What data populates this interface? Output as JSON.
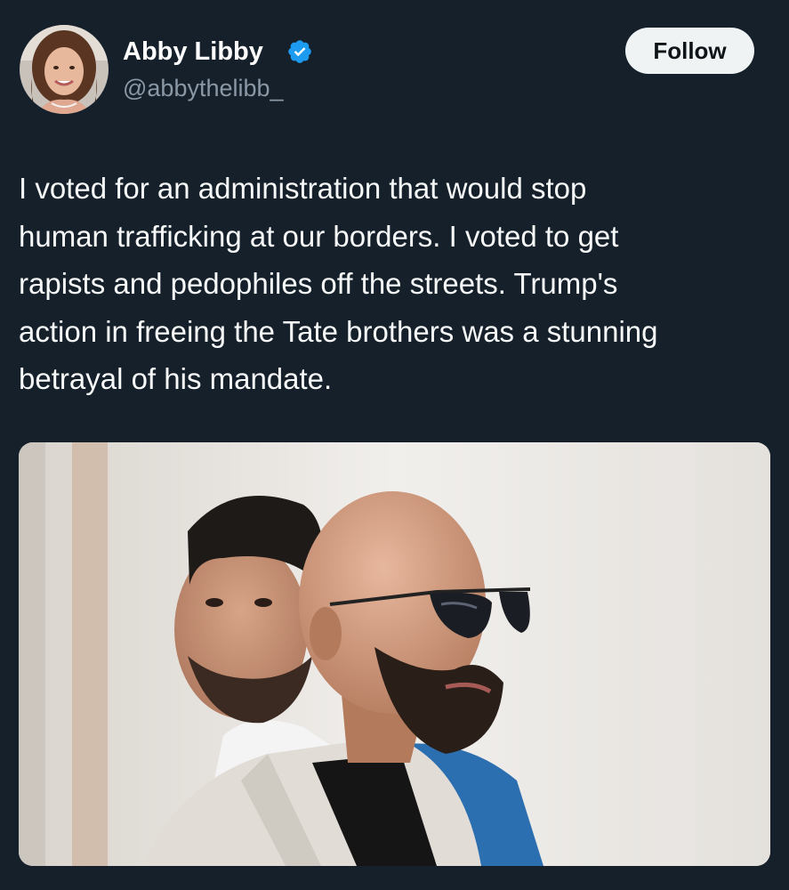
{
  "author": {
    "display_name": "Abby Libby",
    "handle": "@abbythelibb_",
    "verified": true,
    "avatar_icon": "profile-photo"
  },
  "actions": {
    "follow_label": "Follow"
  },
  "tweet": {
    "text_lines": [
      "I voted for an administration that would stop",
      "human trafficking at our borders. I voted to get",
      "rapists and pedophiles off the streets. Trump's",
      "action in freeing the Tate brothers was a stunning",
      "betrayal of his mandate."
    ]
  },
  "media": {
    "icon": "photo-two-men"
  },
  "colors": {
    "background": "#15202b",
    "verified_badge": "#1d9bf0",
    "handle_text": "#8b98a5",
    "follow_button_bg": "#eff3f4",
    "follow_button_text": "#0f1419"
  }
}
